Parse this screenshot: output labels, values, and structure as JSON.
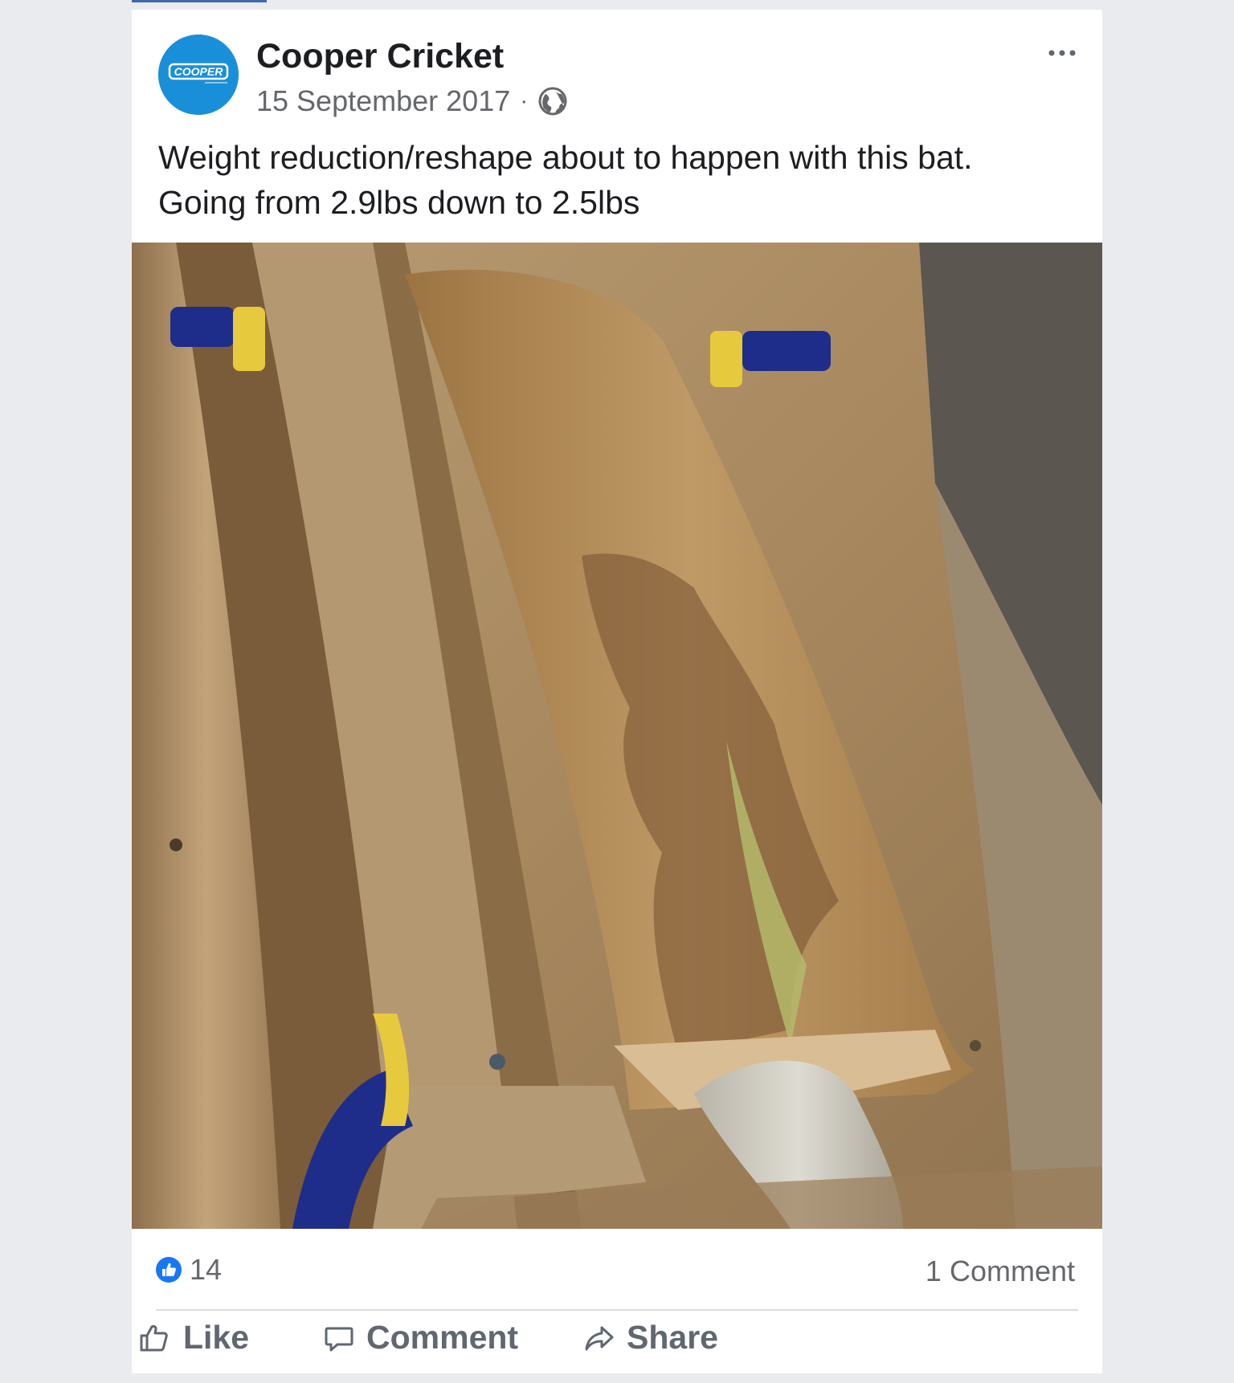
{
  "post": {
    "author": "Cooper Cricket",
    "avatar_text": "COOPER",
    "date": "15 September 2017",
    "separator": "·",
    "privacy_icon": "globe-icon",
    "more_icon": "more-horizontal-icon",
    "text_line1": "Weight reduction/reshape about to happen with this bat.",
    "text_line2": "Going from 2.9lbs down to 2.5lbs"
  },
  "stats": {
    "likes": "14",
    "comments": "1 Comment"
  },
  "actions": {
    "like": "Like",
    "comment": "Comment",
    "share": "Share"
  },
  "colors": {
    "brand_blue": "#1a8fd9",
    "facebook_blue": "#1877f2",
    "background": "#e9ebee"
  }
}
